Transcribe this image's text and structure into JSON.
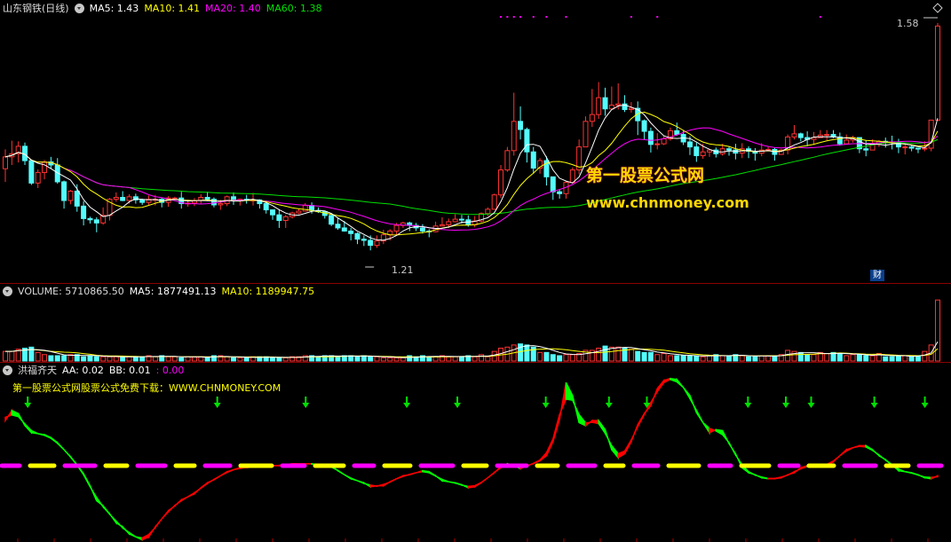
{
  "header": {
    "stock": "山东钢铁(日线)",
    "ma5": "MA5: 1.43",
    "ma10": "MA10: 1.41",
    "ma20": "MA20: 1.40",
    "ma60": "MA60: 1.38"
  },
  "volume_header": {
    "volume": "VOLUME: 5710865.50",
    "ma5": "MA5: 1877491.13",
    "ma10": "MA10: 1189947.75"
  },
  "indicator_header": {
    "name": "洪福齐天",
    "aa": "AA: 0.02",
    "bb": "BB: 0.01",
    "extra": ": 0.00"
  },
  "indicator_note": "第一股票公式网股票公式免费下载：WWW.CHNMONEY.COM",
  "price_labels": {
    "high": "1.58",
    "low": "1.21"
  },
  "watermark": {
    "cn": "第一股票公式网",
    "url": "www.chnmoney.com"
  },
  "badge": "财",
  "colors": {
    "up": "#ff3333",
    "down": "#54fcfc",
    "ma5": "#ffffff",
    "ma10": "#ffff00",
    "ma20": "#ff00ff",
    "ma60": "#00e000",
    "arrow": "#00e000",
    "magenta_dash": "#ff00ff",
    "yellow_dash": "#ffff00",
    "ind_up": "#ff0000",
    "ind_down": "#00ff00"
  },
  "chart_data": {
    "type": "candlestick",
    "title": "山东钢铁(日线)",
    "ylim": [
      1.19,
      1.6
    ],
    "price_high_label": 1.58,
    "price_low_label": 1.21,
    "candles": [
      [
        1.352,
        1.371,
        1.383,
        1.331
      ],
      [
        1.371,
        1.376,
        1.397,
        1.358
      ],
      [
        1.376,
        1.388,
        1.396,
        1.362
      ],
      [
        1.388,
        1.365,
        1.394,
        1.358
      ],
      [
        1.365,
        1.329,
        1.367,
        1.326
      ],
      [
        1.329,
        1.346,
        1.351,
        1.321
      ],
      [
        1.346,
        1.363,
        1.366,
        1.335
      ],
      [
        1.363,
        1.358,
        1.371,
        1.353
      ],
      [
        1.358,
        1.331,
        1.369,
        1.328
      ],
      [
        1.331,
        1.301,
        1.333,
        1.288
      ],
      [
        1.301,
        1.316,
        1.318,
        1.295
      ],
      [
        1.316,
        1.292,
        1.327,
        1.283
      ],
      [
        1.292,
        1.272,
        1.3,
        1.261
      ],
      [
        1.272,
        1.27,
        1.275,
        1.264
      ],
      [
        1.27,
        1.265,
        1.274,
        1.25
      ],
      [
        1.265,
        1.277,
        1.29,
        1.262
      ],
      [
        1.277,
        1.303,
        1.305,
        1.269
      ],
      [
        1.303,
        1.306,
        1.314,
        1.299
      ],
      [
        1.306,
        1.301,
        1.316,
        1.3
      ],
      [
        1.301,
        1.307,
        1.311,
        1.296
      ],
      [
        1.307,
        1.302,
        1.312,
        1.296
      ],
      [
        1.302,
        1.298,
        1.304,
        1.294
      ],
      [
        1.298,
        1.303,
        1.309,
        1.294
      ],
      [
        1.303,
        1.303,
        1.31,
        1.293
      ],
      [
        1.303,
        1.298,
        1.306,
        1.29
      ],
      [
        1.298,
        1.305,
        1.308,
        1.291
      ],
      [
        1.305,
        1.305,
        1.307,
        1.303
      ],
      [
        1.305,
        1.296,
        1.315,
        1.288
      ],
      [
        1.296,
        1.297,
        1.302,
        1.291
      ],
      [
        1.297,
        1.301,
        1.305,
        1.292
      ],
      [
        1.301,
        1.306,
        1.311,
        1.296
      ],
      [
        1.306,
        1.303,
        1.315,
        1.3
      ],
      [
        1.303,
        1.294,
        1.306,
        1.29
      ],
      [
        1.294,
        1.296,
        1.302,
        1.286
      ],
      [
        1.296,
        1.307,
        1.309,
        1.292
      ],
      [
        1.307,
        1.301,
        1.314,
        1.294
      ],
      [
        1.301,
        1.303,
        1.304,
        1.293
      ],
      [
        1.303,
        1.302,
        1.31,
        1.296
      ],
      [
        1.302,
        1.302,
        1.313,
        1.293
      ],
      [
        1.302,
        1.296,
        1.303,
        1.288
      ],
      [
        1.296,
        1.286,
        1.301,
        1.28
      ],
      [
        1.286,
        1.278,
        1.286,
        1.27
      ],
      [
        1.278,
        1.269,
        1.287,
        1.257
      ],
      [
        1.269,
        1.275,
        1.278,
        1.257
      ],
      [
        1.275,
        1.281,
        1.283,
        1.272
      ],
      [
        1.281,
        1.284,
        1.288,
        1.279
      ],
      [
        1.284,
        1.293,
        1.297,
        1.283
      ],
      [
        1.293,
        1.285,
        1.298,
        1.28
      ],
      [
        1.285,
        1.283,
        1.29,
        1.281
      ],
      [
        1.283,
        1.277,
        1.284,
        1.272
      ],
      [
        1.277,
        1.263,
        1.278,
        1.26
      ],
      [
        1.263,
        1.257,
        1.274,
        1.254
      ],
      [
        1.257,
        1.252,
        1.268,
        1.251
      ],
      [
        1.252,
        1.248,
        1.257,
        1.237
      ],
      [
        1.248,
        1.239,
        1.25,
        1.231
      ],
      [
        1.239,
        1.237,
        1.245,
        1.228
      ],
      [
        1.237,
        1.229,
        1.245,
        1.221
      ],
      [
        1.229,
        1.236,
        1.245,
        1.225
      ],
      [
        1.236,
        1.246,
        1.254,
        1.231
      ],
      [
        1.246,
        1.252,
        1.255,
        1.237
      ],
      [
        1.252,
        1.261,
        1.265,
        1.246
      ],
      [
        1.261,
        1.265,
        1.267,
        1.257
      ],
      [
        1.265,
        1.261,
        1.267,
        1.252
      ],
      [
        1.261,
        1.257,
        1.265,
        1.252
      ],
      [
        1.257,
        1.252,
        1.263,
        1.248
      ],
      [
        1.252,
        1.251,
        1.255,
        1.242
      ],
      [
        1.251,
        1.26,
        1.267,
        1.25
      ],
      [
        1.26,
        1.262,
        1.274,
        1.26
      ],
      [
        1.262,
        1.267,
        1.272,
        1.257
      ],
      [
        1.267,
        1.271,
        1.279,
        1.266
      ],
      [
        1.271,
        1.27,
        1.278,
        1.264
      ],
      [
        1.27,
        1.262,
        1.277,
        1.259
      ],
      [
        1.262,
        1.268,
        1.276,
        1.258
      ],
      [
        1.268,
        1.28,
        1.282,
        1.266
      ],
      [
        1.28,
        1.287,
        1.29,
        1.276
      ],
      [
        1.287,
        1.31,
        1.312,
        1.286
      ],
      [
        1.31,
        1.35,
        1.358,
        1.305
      ],
      [
        1.35,
        1.381,
        1.387,
        1.347
      ],
      [
        1.381,
        1.428,
        1.474,
        1.373
      ],
      [
        1.428,
        1.415,
        1.452,
        1.399
      ],
      [
        1.415,
        1.379,
        1.418,
        1.362
      ],
      [
        1.379,
        1.353,
        1.387,
        1.344
      ],
      [
        1.353,
        1.365,
        1.369,
        1.344
      ],
      [
        1.365,
        1.339,
        1.372,
        1.325
      ],
      [
        1.339,
        1.315,
        1.339,
        1.302
      ],
      [
        1.315,
        1.312,
        1.319,
        1.304
      ],
      [
        1.312,
        1.33,
        1.332,
        1.304
      ],
      [
        1.33,
        1.35,
        1.354,
        1.328
      ],
      [
        1.35,
        1.387,
        1.399,
        1.343
      ],
      [
        1.387,
        1.428,
        1.436,
        1.387
      ],
      [
        1.428,
        1.439,
        1.48,
        1.419
      ],
      [
        1.439,
        1.466,
        1.491,
        1.432
      ],
      [
        1.466,
        1.448,
        1.482,
        1.437
      ],
      [
        1.448,
        1.454,
        1.484,
        1.451
      ],
      [
        1.454,
        1.456,
        1.489,
        1.447
      ],
      [
        1.456,
        1.447,
        1.47,
        1.443
      ],
      [
        1.447,
        1.449,
        1.459,
        1.442
      ],
      [
        1.449,
        1.429,
        1.46,
        1.406
      ],
      [
        1.429,
        1.412,
        1.431,
        1.399
      ],
      [
        1.412,
        1.391,
        1.418,
        1.378
      ],
      [
        1.391,
        1.392,
        1.409,
        1.383
      ],
      [
        1.392,
        1.4,
        1.404,
        1.39
      ],
      [
        1.4,
        1.413,
        1.418,
        1.397
      ],
      [
        1.413,
        1.407,
        1.426,
        1.405
      ],
      [
        1.407,
        1.395,
        1.414,
        1.39
      ],
      [
        1.395,
        1.387,
        1.404,
        1.374
      ],
      [
        1.387,
        1.373,
        1.394,
        1.363
      ],
      [
        1.373,
        1.379,
        1.392,
        1.368
      ],
      [
        1.379,
        1.382,
        1.384,
        1.371
      ],
      [
        1.382,
        1.376,
        1.386,
        1.37
      ],
      [
        1.376,
        1.384,
        1.392,
        1.373
      ],
      [
        1.384,
        1.382,
        1.388,
        1.373
      ],
      [
        1.382,
        1.377,
        1.392,
        1.367
      ],
      [
        1.377,
        1.384,
        1.393,
        1.369
      ],
      [
        1.384,
        1.38,
        1.388,
        1.369
      ],
      [
        1.38,
        1.377,
        1.385,
        1.365
      ],
      [
        1.377,
        1.382,
        1.393,
        1.372
      ],
      [
        1.382,
        1.383,
        1.388,
        1.38
      ],
      [
        1.383,
        1.375,
        1.386,
        1.365
      ],
      [
        1.375,
        1.382,
        1.384,
        1.377
      ],
      [
        1.382,
        1.403,
        1.407,
        1.375
      ],
      [
        1.403,
        1.408,
        1.422,
        1.399
      ],
      [
        1.408,
        1.402,
        1.41,
        1.396
      ],
      [
        1.402,
        1.399,
        1.412,
        1.388
      ],
      [
        1.399,
        1.402,
        1.411,
        1.39
      ],
      [
        1.402,
        1.406,
        1.414,
        1.402
      ],
      [
        1.406,
        1.407,
        1.414,
        1.398
      ],
      [
        1.407,
        1.403,
        1.414,
        1.401
      ],
      [
        1.403,
        1.392,
        1.41,
        1.389
      ],
      [
        1.392,
        1.398,
        1.407,
        1.391
      ],
      [
        1.398,
        1.402,
        1.405,
        1.394
      ],
      [
        1.402,
        1.384,
        1.402,
        1.377
      ],
      [
        1.384,
        1.382,
        1.398,
        1.372
      ],
      [
        1.382,
        1.391,
        1.399,
        1.383
      ],
      [
        1.391,
        1.396,
        1.398,
        1.387
      ],
      [
        1.396,
        1.395,
        1.402,
        1.386
      ],
      [
        1.395,
        1.394,
        1.405,
        1.383
      ],
      [
        1.394,
        1.387,
        1.4,
        1.377
      ],
      [
        1.387,
        1.387,
        1.392,
        1.375
      ],
      [
        1.387,
        1.385,
        1.389,
        1.38
      ],
      [
        1.385,
        1.384,
        1.385,
        1.377
      ],
      [
        1.384,
        1.385,
        1.396,
        1.38
      ],
      [
        1.385,
        1.43,
        1.43,
        1.38
      ],
      [
        1.43,
        1.581,
        1.586,
        1.431
      ]
    ],
    "volume": [
      0.9,
      0.9,
      1.1,
      1.2,
      1.3,
      0.8,
      0.6,
      0.5,
      0.5,
      0.5,
      0.6,
      0.6,
      0.4,
      0.5,
      0.4,
      0.4,
      0.4,
      0.4,
      0.4,
      0.4,
      0.4,
      0.4,
      0.5,
      0.4,
      0.5,
      0.4,
      0.4,
      0.3,
      0.4,
      0.4,
      0.4,
      0.3,
      0.5,
      0.5,
      0.4,
      0.3,
      0.3,
      0.3,
      0.4,
      0.4,
      0.4,
      0.3,
      0.3,
      0.3,
      0.4,
      0.4,
      0.5,
      0.5,
      0.4,
      0.5,
      0.5,
      0.4,
      0.5,
      0.5,
      0.4,
      0.5,
      0.4,
      0.4,
      0.3,
      0.3,
      0.3,
      0.3,
      0.5,
      0.4,
      0.5,
      0.4,
      0.4,
      0.5,
      0.4,
      0.4,
      0.4,
      0.5,
      0.4,
      0.6,
      0.4,
      0.9,
      1.2,
      1.3,
      1.5,
      1.6,
      1.5,
      1.3,
      0.8,
      0.8,
      0.6,
      0.5,
      0.6,
      0.6,
      0.7,
      1.0,
      1.0,
      1.2,
      1.4,
      1.3,
      1.3,
      1.2,
      1.1,
      0.9,
      0.8,
      0.8,
      0.6,
      0.7,
      0.5,
      0.5,
      0.5,
      0.5,
      0.5,
      0.4,
      0.5,
      0.6,
      0.5,
      0.5,
      0.6,
      0.5,
      0.4,
      0.4,
      0.5,
      0.5,
      0.5,
      0.6,
      1.0,
      0.9,
      0.8,
      0.6,
      0.6,
      0.8,
      0.7,
      0.8,
      0.7,
      0.5,
      0.6,
      0.6,
      0.5,
      0.5,
      0.7,
      0.4,
      0.4,
      0.5,
      0.5,
      0.4,
      0.5,
      0.9,
      1.5,
      5.7
    ],
    "volume_max": 5.8,
    "indicator": [
      0.045,
      0.055,
      0.052,
      0.04,
      0.033,
      0.032,
      0.031,
      0.028,
      0.023,
      0.016,
      0.009,
      0.001,
      -0.008,
      -0.02,
      -0.035,
      -0.04,
      -0.048,
      -0.057,
      -0.061,
      -0.068,
      -0.071,
      -0.074,
      -0.071,
      -0.061,
      -0.053,
      -0.045,
      -0.04,
      -0.034,
      -0.031,
      -0.028,
      -0.022,
      -0.017,
      -0.014,
      -0.01,
      -0.006,
      -0.004,
      -0.002,
      -0.002,
      -0.001,
      0.0,
      0.0,
      0.0,
      0.0,
      0.001,
      0.002,
      0.002,
      0.002,
      0.002,
      0.001,
      0.001,
      0.0,
      -0.005,
      -0.009,
      -0.013,
      -0.015,
      -0.017,
      -0.021,
      -0.02,
      -0.02,
      -0.016,
      -0.013,
      -0.01,
      -0.009,
      -0.007,
      -0.005,
      -0.006,
      -0.01,
      -0.015,
      -0.016,
      -0.017,
      -0.019,
      -0.022,
      -0.021,
      -0.017,
      -0.012,
      -0.007,
      -0.001,
      0.002,
      0.0,
      -0.003,
      0.0,
      0.002,
      0.005,
      0.01,
      0.024,
      0.046,
      0.083,
      0.07,
      0.043,
      0.04,
      0.045,
      0.045,
      0.036,
      0.016,
      0.008,
      0.012,
      0.024,
      0.041,
      0.052,
      0.06,
      0.077,
      0.085,
      0.087,
      0.086,
      0.078,
      0.07,
      0.053,
      0.043,
      0.033,
      0.036,
      0.035,
      0.022,
      0.012,
      -0.002,
      -0.007,
      -0.009,
      -0.012,
      -0.013,
      -0.013,
      -0.012,
      -0.009,
      -0.007,
      -0.002,
      0.0,
      -0.001,
      0.0,
      0.0,
      0.004,
      0.01,
      0.016,
      0.018,
      0.02,
      0.02,
      0.016,
      0.01,
      0.006,
      0.001,
      -0.005,
      -0.006,
      -0.007,
      -0.009,
      -0.012,
      -0.013,
      -0.01,
      0.0,
      0.014,
      0.065
    ],
    "arrow_bars": [
      1,
      16,
      23,
      31,
      35,
      42,
      47,
      50,
      58,
      61,
      63,
      68,
      72,
      75,
      79,
      83,
      84
    ]
  }
}
